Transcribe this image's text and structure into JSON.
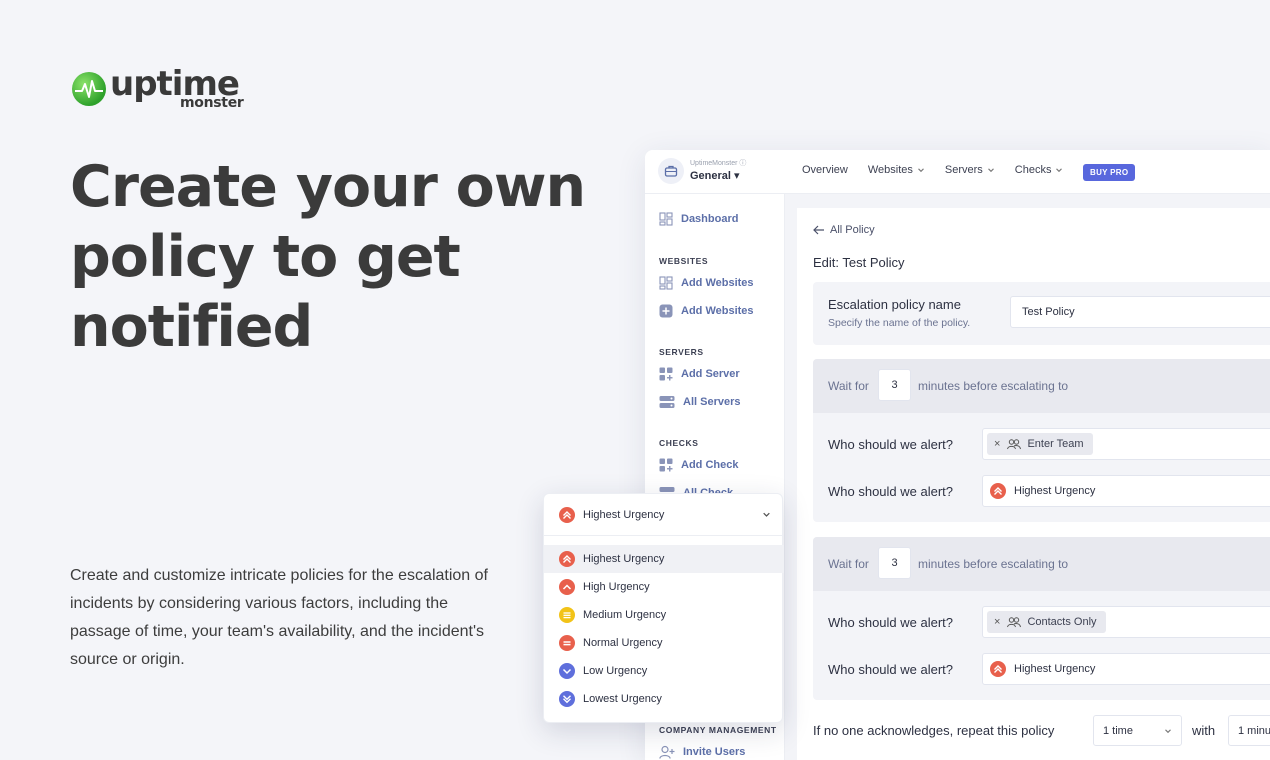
{
  "logo": {
    "word": "uptime",
    "sub": "monster"
  },
  "hero": {
    "title": "Create your own policy to get notified",
    "description": "Create and customize intricate policies for the escalation of incidents by considering various factors, including the passage of time, your team's availability, and the incident's source or origin."
  },
  "app": {
    "org_small": "UptimeMonster",
    "org_name": "General",
    "nav": [
      "Overview",
      "Websites",
      "Servers",
      "Checks"
    ],
    "buy_pro": "BUY PRO",
    "sidebar": {
      "dashboard": "Dashboard",
      "websites_head": "WEBSITES",
      "websites_items": [
        "Add Websites",
        "Add Websites"
      ],
      "servers_head": "SERVERS",
      "servers_items": [
        "Add Server",
        "All Servers"
      ],
      "checks_head": "CHECKS",
      "checks_items": [
        "Add Check",
        "All Check"
      ],
      "company_head": "COMPANY MANAGEMENT",
      "company_items": [
        "Invite Users"
      ]
    },
    "back_link": "All Policy",
    "edit_title": "Edit: Test Policy",
    "policy_name": {
      "label": "Escalation policy name",
      "hint": "Specify the name of the policy.",
      "value": "Test Policy"
    },
    "steps": [
      {
        "wait_prefix": "Wait for",
        "minutes": "3",
        "wait_suffix": "minutes before escalating to",
        "alert_label_1": "Who should we alert?",
        "chip": "Enter Team",
        "alert_label_2": "Who should we alert?",
        "urgency": "Highest Urgency"
      },
      {
        "wait_prefix": "Wait for",
        "minutes": "3",
        "wait_suffix": "minutes before escalating to",
        "alert_label_1": "Who should we alert?",
        "chip": "Contacts Only",
        "alert_label_2": "Who should we alert?",
        "urgency": "Highest Urgency"
      }
    ],
    "repeat": {
      "label": "If no one acknowledges, repeat this policy",
      "times": "1 time",
      "with": "with",
      "interval": "1 minu"
    }
  },
  "dropdown": {
    "selected": "Highest Urgency",
    "options": [
      {
        "label": "Highest Urgency",
        "color": "#e8604c",
        "icon": "double-chevron-up-icon"
      },
      {
        "label": "High Urgency",
        "color": "#e8604c",
        "icon": "chevron-up-icon"
      },
      {
        "label": "Medium Urgency",
        "color": "#f2c318",
        "icon": "lines-icon"
      },
      {
        "label": "Normal Urgency",
        "color": "#e8604c",
        "icon": "equals-icon"
      },
      {
        "label": "Low Urgency",
        "color": "#5f6fdc",
        "icon": "chevron-down-icon"
      },
      {
        "label": "Lowest Urgency",
        "color": "#5f6fdc",
        "icon": "double-chevron-down-icon"
      }
    ]
  },
  "colors": {
    "accent": "#5867dd",
    "urgent": "#e8604c",
    "medium": "#f2c318",
    "low": "#5f6fdc",
    "page_bg": "#f4f5f9"
  }
}
